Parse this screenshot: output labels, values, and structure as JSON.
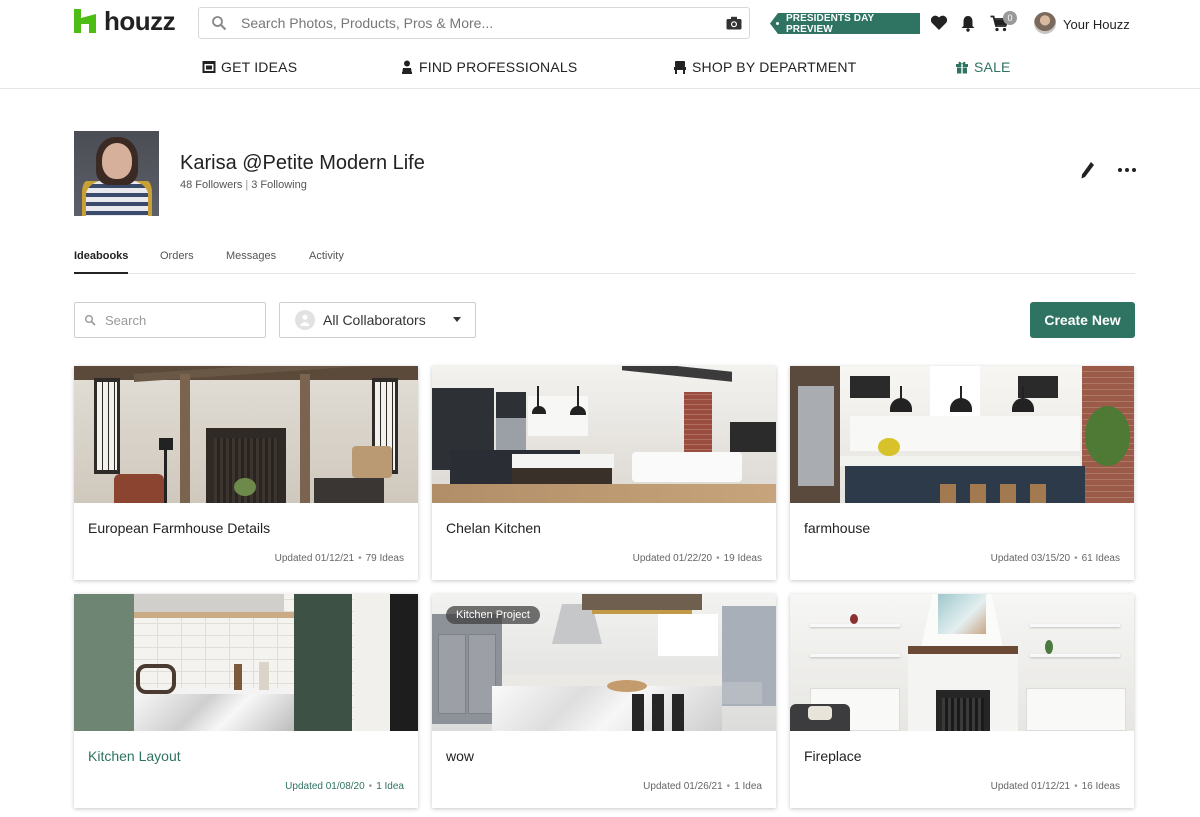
{
  "header": {
    "logo_text": "houzz",
    "search_placeholder": "Search Photos, Products, Pros & More...",
    "promo": "PRESIDENTS DAY PREVIEW",
    "cart_count": "0",
    "user_label": "Your Houzz"
  },
  "nav": {
    "items": [
      {
        "label": "GET IDEAS",
        "icon": "ideas-icon"
      },
      {
        "label": "FIND PROFESSIONALS",
        "icon": "professional-icon"
      },
      {
        "label": "SHOP BY DEPARTMENT",
        "icon": "chair-icon"
      },
      {
        "label": "SALE",
        "icon": "gift-icon"
      }
    ]
  },
  "profile": {
    "name": "Karisa @Petite Modern Life",
    "followers": "48 Followers",
    "following": "3 Following"
  },
  "tabs": [
    "Ideabooks",
    "Orders",
    "Messages",
    "Activity"
  ],
  "filters": {
    "search_placeholder": "Search",
    "collaborators": "All Collaborators",
    "create_label": "Create New"
  },
  "ideabooks": [
    {
      "title": "European Farmhouse Details",
      "updated": "Updated 01/12/21",
      "count": "79 Ideas"
    },
    {
      "title": "Chelan Kitchen",
      "updated": "Updated 01/22/20",
      "count": "19 Ideas"
    },
    {
      "title": "farmhouse",
      "updated": "Updated 03/15/20",
      "count": "61 Ideas"
    },
    {
      "title": "Kitchen Layout",
      "updated": "Updated 01/08/20",
      "count": "1 Idea"
    },
    {
      "title": "wow",
      "updated": "Updated 01/26/21",
      "count": "1 Idea",
      "badge": "Kitchen Project"
    },
    {
      "title": "Fireplace",
      "updated": "Updated 01/12/21",
      "count": "16 Ideas"
    }
  ],
  "colors": {
    "brand_green": "#2f7362",
    "logo_green": "#4dbc15"
  }
}
